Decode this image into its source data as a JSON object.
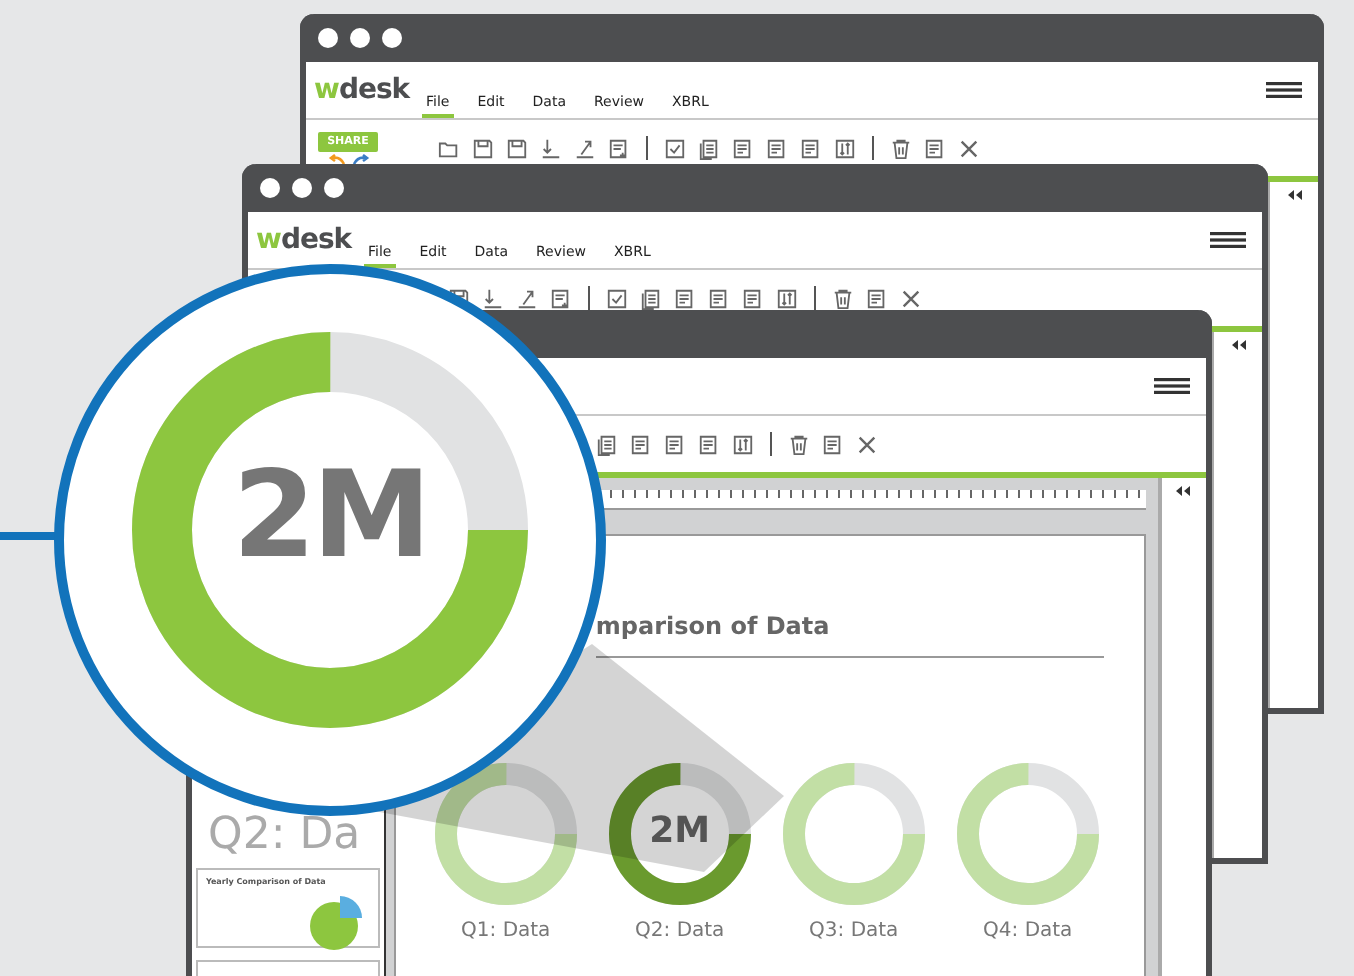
{
  "windows": [
    {
      "logo": "wdesk",
      "menu": [
        {
          "label": "File",
          "selected": true
        },
        {
          "label": "Edit",
          "selected": false
        },
        {
          "label": "Data",
          "selected": false
        },
        {
          "label": "Review",
          "selected": false
        },
        {
          "label": "XBRL",
          "selected": false
        }
      ],
      "share": "SHARE"
    },
    {
      "logo": "wdesk",
      "menu": [
        {
          "label": "File",
          "selected": true
        },
        {
          "label": "Edit",
          "selected": false
        },
        {
          "label": "Data",
          "selected": false
        },
        {
          "label": "Review",
          "selected": false
        },
        {
          "label": "XBRL",
          "selected": false
        }
      ]
    },
    {
      "document": {
        "fragment": "Q2: Da",
        "thumbnail_title": "Yearly Comparison of Data",
        "title": "mparison of Data",
        "donuts": [
          {
            "label": "Q1: Data",
            "level": 0.75,
            "selected": false
          },
          {
            "label": "Q2: Data",
            "value": "2M",
            "level": 0.75,
            "selected": true
          },
          {
            "label": "Q3: Data",
            "level": 0.75,
            "selected": false
          },
          {
            "label": "Q4: Data",
            "level": 0.75,
            "selected": false
          }
        ]
      }
    }
  ],
  "magnifier": {
    "value": "2M",
    "level": 0.75
  }
}
